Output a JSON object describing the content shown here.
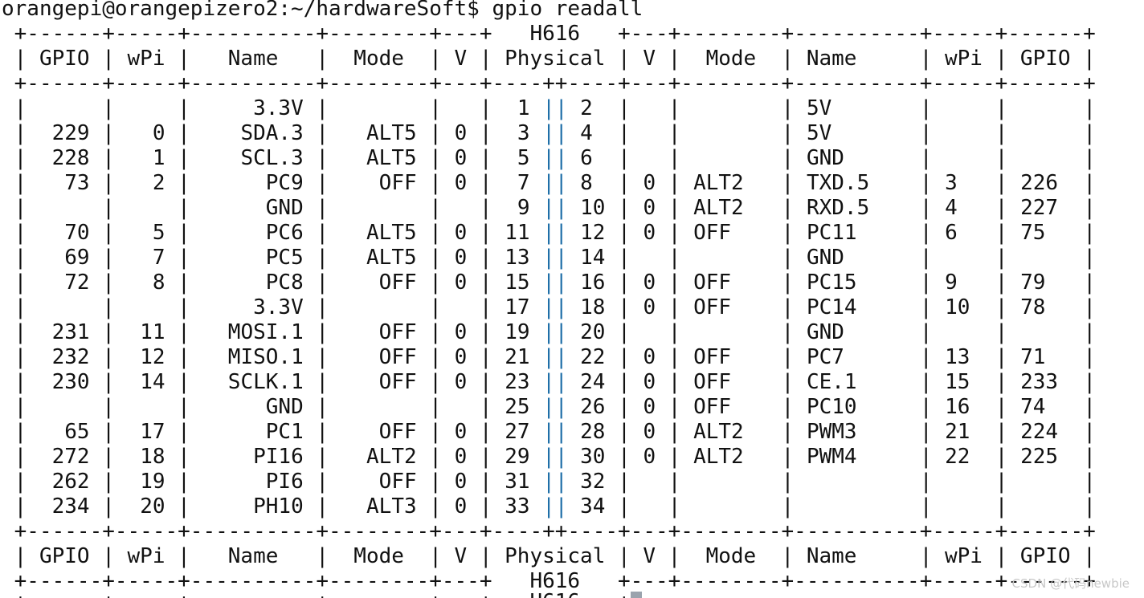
{
  "prompt": "orangepi@orangepizero2:~/hardwareSoft$ gpio readall",
  "board": "H616",
  "border": " +------+-----+----------+--------+---+   H616   +---+--------+----------+-----+------+",
  "separator": " +------+-----+----------+--------+---+----++----+---+--------+----------+-----+------+",
  "header": " | GPIO | wPi |   Name   |  Mode  | V | Physical | V |  Mode  | Name     | wPi | GPIO |",
  "rows": [
    {
      "gpio_l": "",
      "wpi_l": "",
      "name_l": "3.3V",
      "mode_l": "",
      "v_l": "",
      "phys_l": "1",
      "phys_r": "2",
      "v_r": "",
      "mode_r": "",
      "name_r": "5V",
      "wpi_r": "",
      "gpio_r": ""
    },
    {
      "gpio_l": "229",
      "wpi_l": "0",
      "name_l": "SDA.3",
      "mode_l": "ALT5",
      "v_l": "0",
      "phys_l": "3",
      "phys_r": "4",
      "v_r": "",
      "mode_r": "",
      "name_r": "5V",
      "wpi_r": "",
      "gpio_r": ""
    },
    {
      "gpio_l": "228",
      "wpi_l": "1",
      "name_l": "SCL.3",
      "mode_l": "ALT5",
      "v_l": "0",
      "phys_l": "5",
      "phys_r": "6",
      "v_r": "",
      "mode_r": "",
      "name_r": "GND",
      "wpi_r": "",
      "gpio_r": ""
    },
    {
      "gpio_l": "73",
      "wpi_l": "2",
      "name_l": "PC9",
      "mode_l": "OFF",
      "v_l": "0",
      "phys_l": "7",
      "phys_r": "8",
      "v_r": "0",
      "mode_r": "ALT2",
      "name_r": "TXD.5",
      "wpi_r": "3",
      "gpio_r": "226"
    },
    {
      "gpio_l": "",
      "wpi_l": "",
      "name_l": "GND",
      "mode_l": "",
      "v_l": "",
      "phys_l": "9",
      "phys_r": "10",
      "v_r": "0",
      "mode_r": "ALT2",
      "name_r": "RXD.5",
      "wpi_r": "4",
      "gpio_r": "227"
    },
    {
      "gpio_l": "70",
      "wpi_l": "5",
      "name_l": "PC6",
      "mode_l": "ALT5",
      "v_l": "0",
      "phys_l": "11",
      "phys_r": "12",
      "v_r": "0",
      "mode_r": "OFF",
      "name_r": "PC11",
      "wpi_r": "6",
      "gpio_r": "75"
    },
    {
      "gpio_l": "69",
      "wpi_l": "7",
      "name_l": "PC5",
      "mode_l": "ALT5",
      "v_l": "0",
      "phys_l": "13",
      "phys_r": "14",
      "v_r": "",
      "mode_r": "",
      "name_r": "GND",
      "wpi_r": "",
      "gpio_r": ""
    },
    {
      "gpio_l": "72",
      "wpi_l": "8",
      "name_l": "PC8",
      "mode_l": "OFF",
      "v_l": "0",
      "phys_l": "15",
      "phys_r": "16",
      "v_r": "0",
      "mode_r": "OFF",
      "name_r": "PC15",
      "wpi_r": "9",
      "gpio_r": "79"
    },
    {
      "gpio_l": "",
      "wpi_l": "",
      "name_l": "3.3V",
      "mode_l": "",
      "v_l": "",
      "phys_l": "17",
      "phys_r": "18",
      "v_r": "0",
      "mode_r": "OFF",
      "name_r": "PC14",
      "wpi_r": "10",
      "gpio_r": "78"
    },
    {
      "gpio_l": "231",
      "wpi_l": "11",
      "name_l": "MOSI.1",
      "mode_l": "OFF",
      "v_l": "0",
      "phys_l": "19",
      "phys_r": "20",
      "v_r": "",
      "mode_r": "",
      "name_r": "GND",
      "wpi_r": "",
      "gpio_r": ""
    },
    {
      "gpio_l": "232",
      "wpi_l": "12",
      "name_l": "MISO.1",
      "mode_l": "OFF",
      "v_l": "0",
      "phys_l": "21",
      "phys_r": "22",
      "v_r": "0",
      "mode_r": "OFF",
      "name_r": "PC7",
      "wpi_r": "13",
      "gpio_r": "71"
    },
    {
      "gpio_l": "230",
      "wpi_l": "14",
      "name_l": "SCLK.1",
      "mode_l": "OFF",
      "v_l": "0",
      "phys_l": "23",
      "phys_r": "24",
      "v_r": "0",
      "mode_r": "OFF",
      "name_r": "CE.1",
      "wpi_r": "15",
      "gpio_r": "233"
    },
    {
      "gpio_l": "",
      "wpi_l": "",
      "name_l": "GND",
      "mode_l": "",
      "v_l": "",
      "phys_l": "25",
      "phys_r": "26",
      "v_r": "0",
      "mode_r": "OFF",
      "name_r": "PC10",
      "wpi_r": "16",
      "gpio_r": "74"
    },
    {
      "gpio_l": "65",
      "wpi_l": "17",
      "name_l": "PC1",
      "mode_l": "OFF",
      "v_l": "0",
      "phys_l": "27",
      "phys_r": "28",
      "v_r": "0",
      "mode_r": "ALT2",
      "name_r": "PWM3",
      "wpi_r": "21",
      "gpio_r": "224"
    },
    {
      "gpio_l": "272",
      "wpi_l": "18",
      "name_l": "PI16",
      "mode_l": "ALT2",
      "v_l": "0",
      "phys_l": "29",
      "phys_r": "30",
      "v_r": "0",
      "mode_r": "ALT2",
      "name_r": "PWM4",
      "wpi_r": "22",
      "gpio_r": "225"
    },
    {
      "gpio_l": "262",
      "wpi_l": "19",
      "name_l": "PI6",
      "mode_l": "OFF",
      "v_l": "0",
      "phys_l": "31",
      "phys_r": "32",
      "v_r": "",
      "mode_r": "",
      "name_r": "",
      "wpi_r": "",
      "gpio_r": ""
    },
    {
      "gpio_l": "234",
      "wpi_l": "20",
      "name_l": "PH10",
      "mode_l": "ALT3",
      "v_l": "0",
      "phys_l": "33",
      "phys_r": "34",
      "v_r": "",
      "mode_r": "",
      "name_r": "",
      "wpi_r": "",
      "gpio_r": ""
    }
  ],
  "partial_line": " +------+-----+----------+--------+---+   H616   +",
  "watermark": "CSDN @代码newbie",
  "colors": {
    "background": "#ffffff",
    "text": "#111111",
    "pin_divider": "#1f6fa8"
  }
}
